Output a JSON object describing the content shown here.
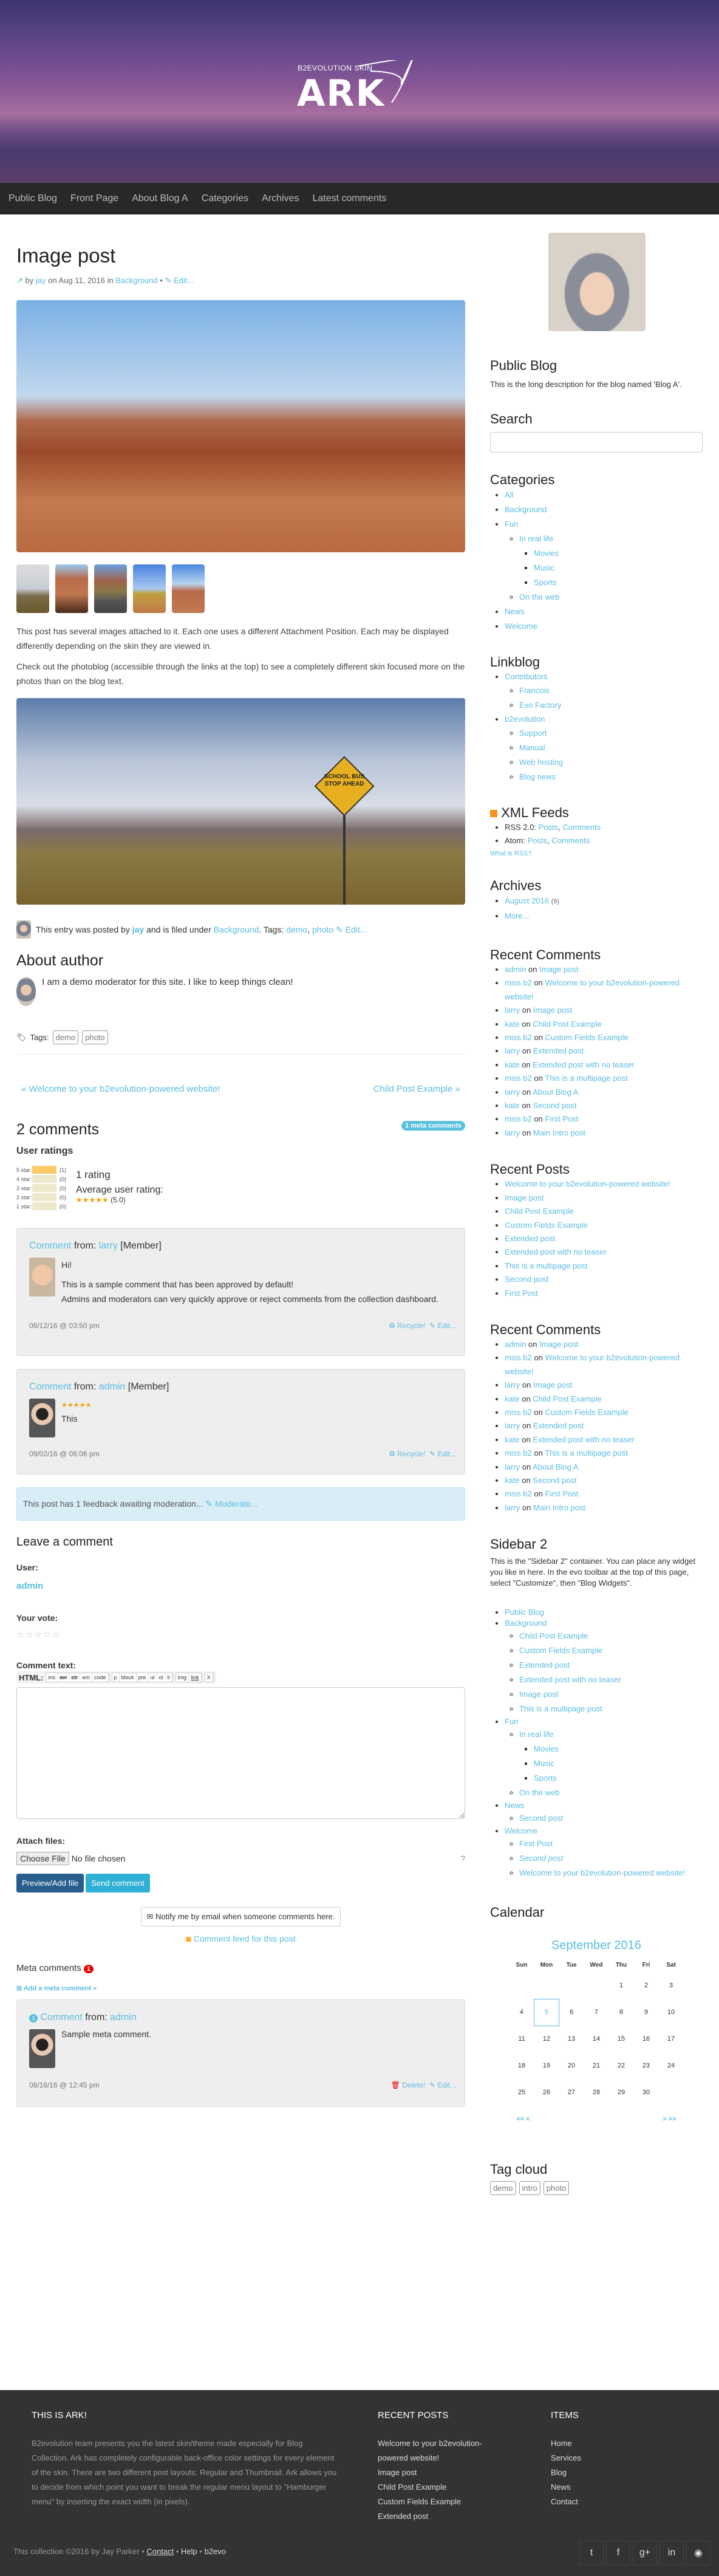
{
  "logo": {
    "sub": "B2EVOLUTION SKIN",
    "name": "ARK"
  },
  "nav": [
    "Public Blog",
    "Front Page",
    "About Blog A",
    "Categories",
    "Archives",
    "Latest comments"
  ],
  "post": {
    "title": "Image post",
    "by": "by",
    "author": "jay",
    "on": "on Aug 11, 2016 in",
    "category": "Background",
    "edit": "Edit...",
    "p1": "This post has several images attached to it. Each one uses a different Attachment Position. Each may be displayed differently depending on the skin they are viewed in.",
    "p2": "Check out the photoblog (accessible through the links at the top) to see a completely different skin focused more on the photos than on the blog text.",
    "sign": "SCHOOL BUS STOP AHEAD",
    "entry_a": "This entry was posted by",
    "entry_b": "and is filed under",
    "entry_c": ". Tags:",
    "tag1": "demo",
    "tag2": "photo",
    "about_title": "About author",
    "about_text": "I am a demo moderator for this site. I like to keep things clean!",
    "tags_label": "Tags:",
    "prev": "« Welcome to your b2evolution-powered website!",
    "next": "Child Post Example »"
  },
  "comments": {
    "title": "2 comments",
    "meta_badge": "1 meta comments",
    "ratings_title": "User ratings",
    "ratings": [
      {
        "label": "5 star:",
        "count": "(1)",
        "fraction": 1
      },
      {
        "label": "4 star:",
        "count": "(0)",
        "fraction": 0
      },
      {
        "label": "3 star:",
        "count": "(0)",
        "fraction": 0
      },
      {
        "label": "2 star:",
        "count": "(0)",
        "fraction": 0
      },
      {
        "label": "1 star:",
        "count": "(0)",
        "fraction": 0
      }
    ],
    "rating_count": "1 rating",
    "avg_label": "Average user rating:",
    "avg_stars": "★★★★★",
    "avg_value": "(5.0)",
    "items": [
      {
        "comment": "Comment",
        "from": "from:",
        "user": "larry",
        "role": "[Member]",
        "line1": "Hi!",
        "line2": "This is a sample comment that has been approved by default!",
        "line3": "Admins and moderators can very quickly approve or reject comments from the collection dashboard.",
        "date": "08/12/16 @ 03:50 pm",
        "recycle": "Recycle!",
        "edit": "Edit..."
      },
      {
        "comment": "Comment",
        "from": "from:",
        "user": "admin",
        "role": "[Member]",
        "stars": "★★★★★",
        "line1": "This",
        "date": "09/02/16 @ 06:06 pm",
        "recycle": "Recycle!",
        "edit": "Edit..."
      }
    ],
    "moderation": "This post has 1 feedback awaiting moderation...",
    "moderate": "Moderate..."
  },
  "form": {
    "title": "Leave a comment",
    "user_label": "User:",
    "user": "admin",
    "vote_label": "Your vote:",
    "text_label": "Comment text:",
    "html_label": "HTML:",
    "tools": [
      [
        "ins",
        "del",
        "str",
        "em",
        "code"
      ],
      [
        "p",
        "block",
        "pre",
        "ul",
        "ol",
        "li"
      ],
      [
        "img",
        "link"
      ],
      [
        "X"
      ]
    ],
    "attach_label": "Attach files:",
    "choose": "Choose File",
    "no_file": "No file chosen",
    "preview": "Preview/Add file",
    "send": "Send comment",
    "notify": "Notify me by email when someone comments here.",
    "feed": "Comment feed for this post"
  },
  "meta": {
    "title": "Meta comments",
    "count": "1",
    "add": "Add a meta comment »",
    "num": "1",
    "comment": "Comment",
    "from": "from:",
    "user": "admin",
    "text": "Sample meta comment.",
    "date": "08/16/16 @ 12:45 pm",
    "delete": "Delete!",
    "edit": "Edit..."
  },
  "sidebar": {
    "blog_title": "Public Blog",
    "blog_desc": "This is the long description for the blog named 'Blog A'.",
    "search_title": "Search",
    "search_value": "",
    "categories_title": "Categories",
    "linkblog_title": "Linkblog",
    "feeds_title": "XML Feeds",
    "rss": "RSS 2.0:",
    "atom": "Atom:",
    "posts": "Posts",
    "comments": "Comments",
    "what_rss": "What is RSS?",
    "archives_title": "Archives",
    "archive_month": "August 2016",
    "archive_count": "(9)",
    "more": "More...",
    "recent_comments_title": "Recent Comments",
    "recent_comments": [
      [
        "admin",
        "Image post"
      ],
      [
        "miss b2",
        "Welcome to your b2evolution-powered website!"
      ],
      [
        "larry",
        "Image post"
      ],
      [
        "kate",
        "Child Post Example"
      ],
      [
        "miss b2",
        "Custom Fields Example"
      ],
      [
        "larry",
        "Extended post"
      ],
      [
        "kate",
        "Extended post with no teaser"
      ],
      [
        "miss b2",
        "This is a multipage post"
      ],
      [
        "larry",
        "About Blog A"
      ],
      [
        "kate",
        "Second post"
      ],
      [
        "miss b2",
        "First Post"
      ],
      [
        "larry",
        "Main Intro post"
      ]
    ],
    "on": "on",
    "recent_posts_title": "Recent Posts",
    "recent_posts": [
      "Welcome to your b2evolution-powered website!",
      "Image post",
      "Child Post Example",
      "Custom Fields Example",
      "Extended post",
      "Extended post with no teaser",
      "This is a multipage post",
      "Second post",
      "First Post"
    ],
    "sidebar2_title": "Sidebar 2",
    "sidebar2_text": "This is the \"Sidebar 2\" container. You can place any widget you like in here. In the evo toolbar at the top of this page, select \"Customize\", then \"Blog Widgets\".",
    "calendar_title": "Calendar",
    "month": "September 2016",
    "weekdays": [
      "Sun",
      "Mon",
      "Tue",
      "Wed",
      "Thu",
      "Fri",
      "Sat"
    ],
    "today": "5",
    "cal_nav": [
      "<<",
      "<",
      ">",
      ">>"
    ],
    "tagcloud_title": "Tag cloud",
    "tags": [
      "demo",
      "intro",
      "photo"
    ]
  },
  "footer": {
    "c1_title": "THIS IS ARK!",
    "c1_text": "B2evolution team presents you the latest skin/theme made especially for Blog Collection. Ark has completely configurable back-office color settings for every element of the skin. There are two different post layouts: Regular and Thumbnail. Ark allows you to decide from which point you want to break the regular menu layout to \"Hamburger menu\" by inserting the exact width (in pixels).",
    "c2_title": "RECENT POSTS",
    "c2": [
      "Welcome to your b2evolution-powered website!",
      "Image post",
      "Child Post Example",
      "Custom Fields Example",
      "Extended post"
    ],
    "c3_title": "ITEMS",
    "c3": [
      "Home",
      "Services",
      "Blog",
      "News",
      "Contact"
    ],
    "copy": "This collection ©2016 by Jay Parker",
    "contact": "Contact",
    "help": "Help",
    "b2evo": "b2evo",
    "sep": "•",
    "social": [
      "twitter-icon",
      "facebook-icon",
      "google-plus-icon",
      "linkedin-icon",
      "github-icon"
    ]
  }
}
